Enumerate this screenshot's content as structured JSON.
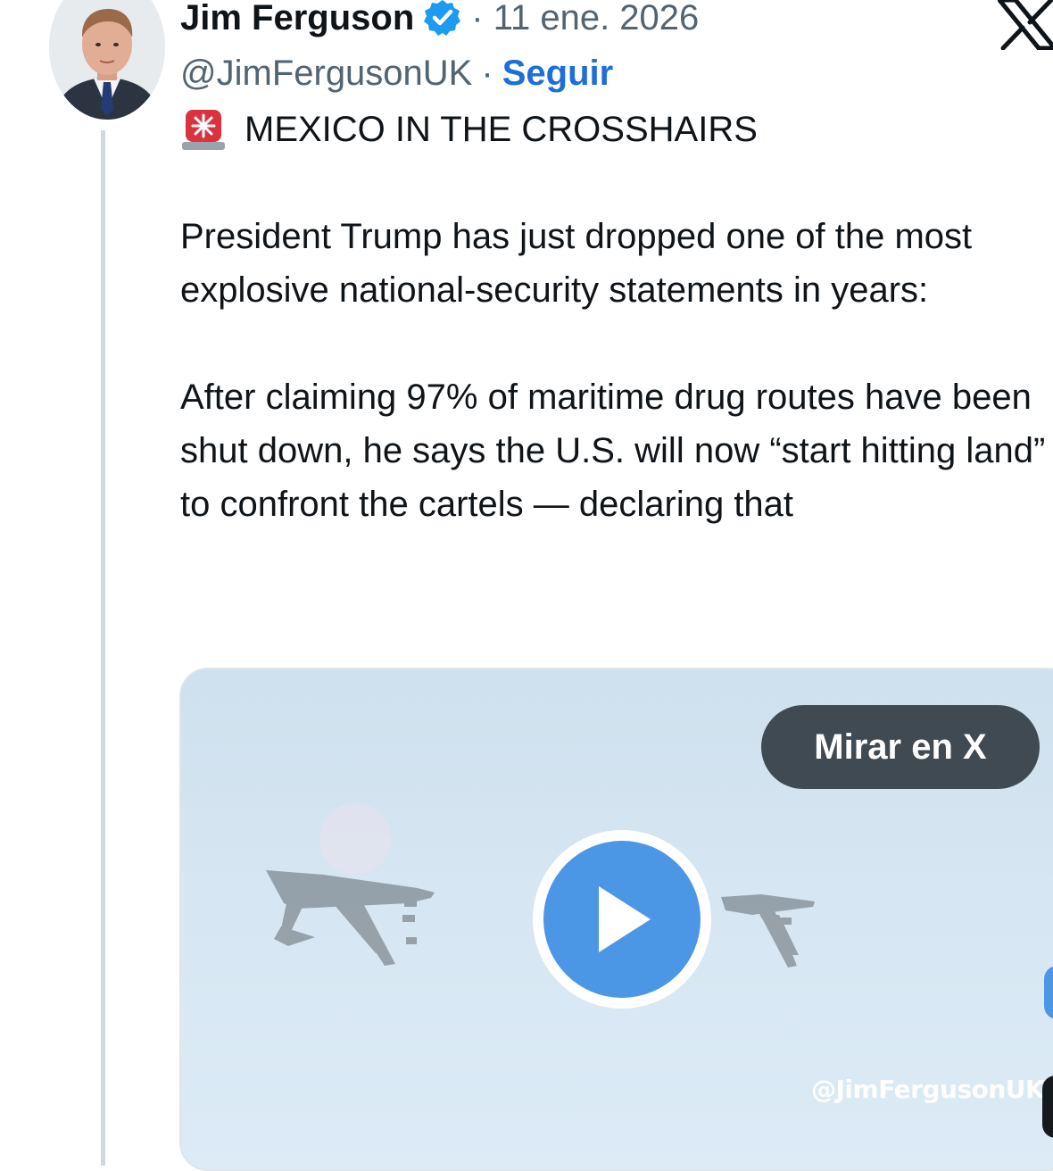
{
  "author": {
    "name": "Jim Ferguson",
    "handle": "@JimFergusonUK",
    "separator": "·",
    "follow_label": "Seguir",
    "date": "· 11 ene. 2026",
    "verified": true
  },
  "post": {
    "headline_icon": "siren-icon",
    "headline": "MEXICO IN THE CROSSHAIRS",
    "paragraphs": [
      "President Trump has just dropped one of the most explosive national-security statements in years:",
      "After claiming 97% of maritime drug routes have been shut down, he says the U.S. will now “start hitting land” to confront the cartels — declaring that"
    ]
  },
  "media": {
    "type": "video",
    "watch_label": "Mirar en X",
    "watermark": "@JimFergusonUK"
  },
  "colors": {
    "accent": "#1d6ed8",
    "verified": "#1d9bf0",
    "play": "#4c96e6",
    "pill": "#3f4a52",
    "muted_text": "#536471"
  }
}
